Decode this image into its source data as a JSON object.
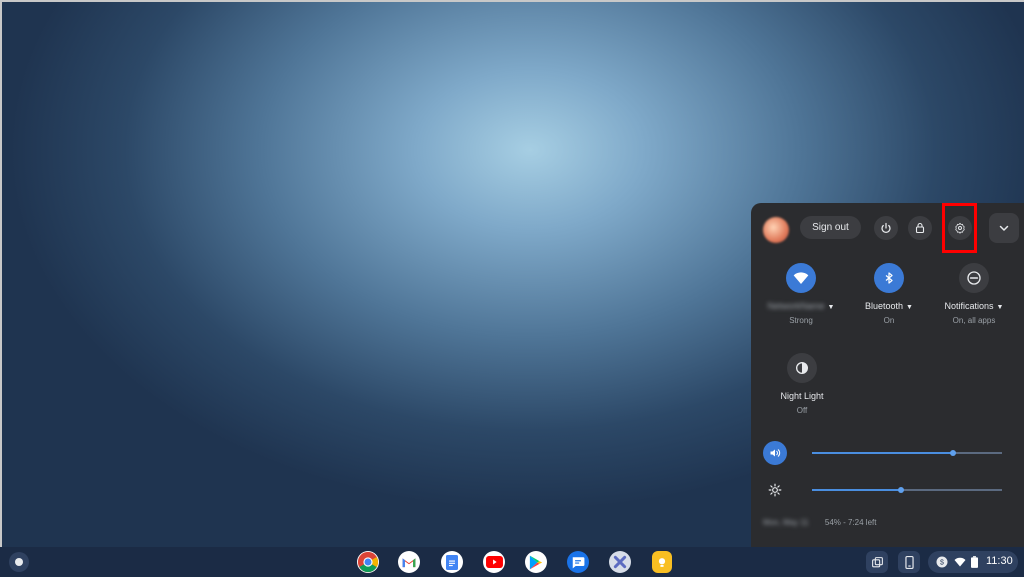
{
  "quick_settings": {
    "sign_out_label": "Sign out",
    "network": {
      "name": "NetworkName",
      "status": "Strong"
    },
    "bluetooth": {
      "label": "Bluetooth",
      "status": "On"
    },
    "notifications": {
      "label": "Notifications",
      "status": "On, all apps"
    },
    "night_light": {
      "label": "Night Light",
      "status": "Off"
    },
    "volume_level": 0.74,
    "brightness_level": 0.47,
    "battery": {
      "device": "Mon, May 11",
      "text": "54% - 7:24 left"
    }
  },
  "shelf": {
    "clock": "11:30",
    "apps": [
      "chrome-icon",
      "gmail-icon",
      "docs-icon",
      "youtube-icon",
      "play-store-icon",
      "messages-icon",
      "app-icon",
      "keep-icon"
    ]
  },
  "colors": {
    "accent": "#3b7ad6",
    "highlight": "#ff0000",
    "panel": "#2b2c2f",
    "shelf": "#1b2b45"
  }
}
